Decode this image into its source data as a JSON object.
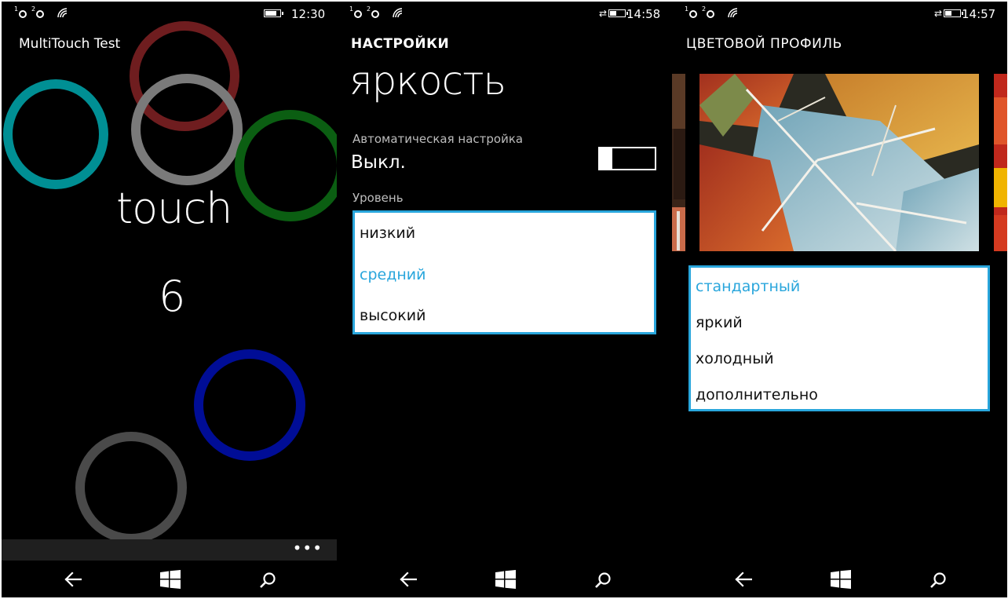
{
  "phones": [
    {
      "status": {
        "sim1": "1",
        "sim2": "2",
        "time": "12:30"
      },
      "title": "MultiTouch Test",
      "touch_label": "touch",
      "touch_count": "6",
      "touch_rings": [
        {
          "color": "#008f94"
        },
        {
          "color": "#6f1d1f"
        },
        {
          "color": "#7a7a7a"
        },
        {
          "color": "#0b5e12"
        },
        {
          "color": "#000d96"
        },
        {
          "color": "#4a4a4a"
        }
      ],
      "appbar_more": "•••"
    },
    {
      "status": {
        "sim1": "1",
        "sim2": "2",
        "time": "14:58"
      },
      "section_title": "НАСТРОЙКИ",
      "heading": "яркость",
      "auto_label": "Автоматическая настройка",
      "auto_value": "Выкл.",
      "level_label": "Уровень",
      "level_options": [
        "низкий",
        "средний",
        "высокий"
      ],
      "level_selected": "средний"
    },
    {
      "status": {
        "sim1": "1",
        "sim2": "2",
        "time": "14:57"
      },
      "section_title": "ЦВЕТОВОЙ ПРОФИЛЬ",
      "profile_options": [
        "стандартный",
        "яркий",
        "холодный",
        "дополнительно"
      ],
      "profile_selected": "стандартный"
    }
  ],
  "colors": {
    "accent": "#29a6dc",
    "background": "#000000"
  }
}
